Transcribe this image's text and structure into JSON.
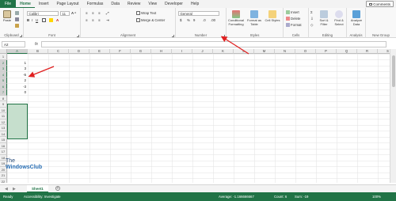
{
  "tabs": [
    "File",
    "Home",
    "Insert",
    "Page Layout",
    "Formulas",
    "Data",
    "Review",
    "View",
    "Developer",
    "Help"
  ],
  "active_tab": "Home",
  "comments_label": "Comments",
  "ribbon": {
    "clipboard": {
      "paste": "Paste",
      "label": "Clipboard"
    },
    "font": {
      "name": "Calibri",
      "size": "11",
      "label": "Font"
    },
    "alignment": {
      "wrap": "Wrap Text",
      "merge": "Merge & Center",
      "label": "Alignment"
    },
    "number": {
      "format": "General",
      "dollar": "$",
      "percent": "%",
      "comma": "9",
      "label": "Number"
    },
    "styles": {
      "conditional": "Conditional Formatting",
      "format_table": "Format as Table",
      "cell_styles": "Cell Styles",
      "label": "Styles"
    },
    "cells": {
      "insert": "Insert",
      "delete": "Delete",
      "format": "Format",
      "label": "Cells"
    },
    "editing": {
      "sort": "Sort & Filter",
      "find": "Find & Select",
      "label": "Editing"
    },
    "analysis": {
      "analyze": "Analyze Data",
      "label": "Analysis"
    },
    "newgroup": {
      "label": "New Group"
    }
  },
  "formula_bar": {
    "name_box": "A2",
    "fx": "fx"
  },
  "columns": [
    "A",
    "B",
    "C",
    "D",
    "E",
    "F",
    "G",
    "H",
    "I",
    "J",
    "K",
    "L",
    "M",
    "N",
    "O",
    "P",
    "Q",
    "R",
    "S"
  ],
  "rows": [
    "1",
    "2",
    "3",
    "4",
    "5",
    "6",
    "7",
    "8",
    "9",
    "10",
    "11",
    "12",
    "13",
    "14",
    "15",
    "16",
    "17",
    "18",
    "19",
    "20",
    "21",
    "22"
  ],
  "cells": {
    "A2": "1",
    "A3": "3",
    "A4": "-5",
    "A5": "2",
    "A6": "-3",
    "A7": "0"
  },
  "sheet_tab": "Sheet1",
  "status": {
    "ready": "Ready",
    "accessibility": "Accessibility: Investigate",
    "average": "Average: -1.166666667",
    "count": "Count: 6",
    "sum": "Sum: -19",
    "zoom": "100%"
  },
  "watermark": {
    "line1": "The",
    "line2": "WindowsClub"
  }
}
